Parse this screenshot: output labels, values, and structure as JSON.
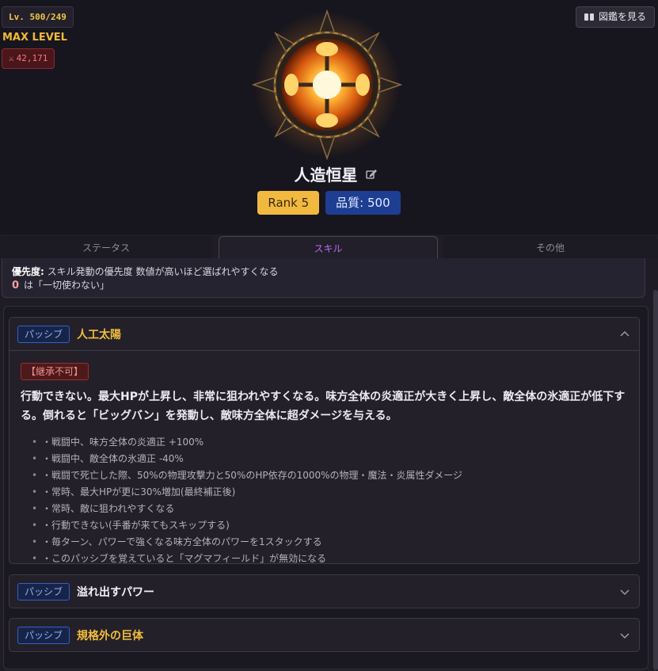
{
  "header": {
    "level": "Lv. 500/249",
    "max_level": "MAX LEVEL",
    "power_icon": "crossed-swords-icon",
    "power": "42,171",
    "zukan_button": "図鑑を見る",
    "name": "人造恒星",
    "rank": "Rank 5",
    "quality": "品質: 500"
  },
  "tabs": [
    "ステータス",
    "スキル",
    "その他"
  ],
  "priority": {
    "label": "優先度:",
    "text": "スキル発動の優先度 数値が高いほど選ばれやすくなる",
    "zero": "0",
    "zero_text": "は「一切使わない」"
  },
  "skills": [
    {
      "tag": "パッシブ",
      "name": "人工太陽",
      "inherit": "【継承不可】",
      "description": "行動できない。最大HPが上昇し、非常に狙われやすくなる。味方全体の炎適正が大きく上昇し、敵全体の氷適正が低下する。倒れると「ビッグバン」を発動し、敵味方全体に超ダメージを与える。",
      "effects": [
        "・戦闘中、味方全体の炎適正 +100%",
        "・戦闘中、敵全体の氷適正 -40%",
        "・戦闘で死亡した際、50%の物理攻撃力と50%のHP依存の1000%の物理・魔法・炎属性ダメージ",
        "・常時、最大HPが更に30%増加(最終補正後)",
        "・常時、敵に狙われやすくなる",
        "・行動できない(手番が来てもスキップする)",
        "・毎ターン、パワーで強くなる味方全体のパワーを1スタックする",
        "・このパッシブを覚えていると「マグマフィールド」が無効になる"
      ]
    },
    {
      "tag": "パッシブ",
      "name": "溢れ出すパワー"
    },
    {
      "tag": "パッシブ",
      "name": "規格外の巨体"
    }
  ],
  "colors": {
    "gold": "#f2be3c",
    "accent_purple": "#b56cf2",
    "quality_blue": "#1e3e94",
    "rank_yellow": "#f2b940"
  }
}
